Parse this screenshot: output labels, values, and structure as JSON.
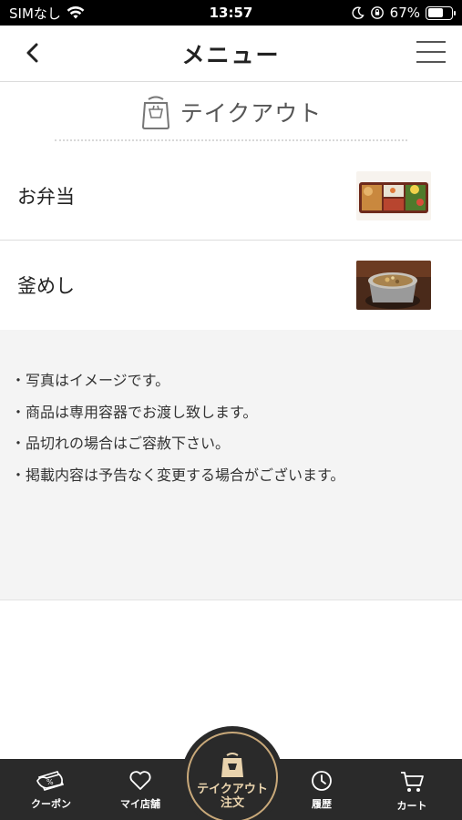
{
  "status": {
    "carrier": "SIMなし",
    "time": "13:57",
    "battery": "67%",
    "battery_level": 0.67
  },
  "nav": {
    "title": "メニュー"
  },
  "section": {
    "title": "テイクアウト"
  },
  "menu_items": [
    {
      "label": "お弁当",
      "thumb": "bento-photo"
    },
    {
      "label": "釜めし",
      "thumb": "kamameshi-photo"
    }
  ],
  "notes": [
    "・写真はイメージです。",
    "・商品は専用容器でお渡し致します。",
    "・品切れの場合はご容赦下さい。",
    "・掲載内容は予告なく変更する場合がございます。"
  ],
  "tabbar": {
    "coupon": "クーポン",
    "my_store": "マイ店舗",
    "takeout_line1": "テイクアウト",
    "takeout_line2": "注文",
    "history": "履歴",
    "cart": "カート"
  },
  "colors": {
    "tabbar_bg": "#2a2a2a",
    "accent_gold": "#c9a97a",
    "notes_bg": "#f4f4f4"
  }
}
